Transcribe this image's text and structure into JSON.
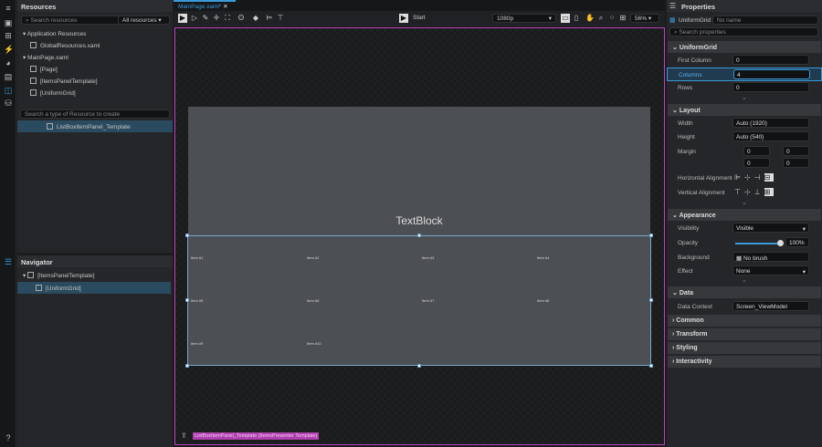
{
  "resources": {
    "title": "Resources",
    "search_placeholder": "Search resources",
    "filter": "All resources",
    "tree": [
      "Application Resources",
      "GlobalResources.xaml",
      "MainPage.xaml",
      "[Page]",
      "[ItemsPanelTemplate]",
      "[UniformGrid]"
    ],
    "create_placeholder": "Search a type of Resource to create",
    "selected_resource": "ListBoxItemPanel_Template"
  },
  "navigator": {
    "title": "Navigator",
    "items": [
      "[ItemsPanelTemplate]",
      "[UniformGrid]"
    ]
  },
  "document": {
    "tab": "MainPage.xaml*",
    "start_label": "Start",
    "resolution": "1080p",
    "zoom": "56%"
  },
  "canvas": {
    "textblock": "TextBlock",
    "items": [
      "Item #1",
      "Item #2",
      "Item #3",
      "Item #4",
      "Item #5",
      "Item #6",
      "Item #7",
      "Item #8",
      "Item #9",
      "Item #10"
    ],
    "breadcrumb": "ListBoxItemPanel_Template (ItemsPresenter Template)"
  },
  "properties": {
    "title": "Properties",
    "element_type": "UniformGrid",
    "name_placeholder": "No name",
    "search_placeholder": "Search properties",
    "uniformgrid": {
      "title": "UniformGrid",
      "first_column_label": "First Column",
      "first_column": "0",
      "columns_label": "Columns",
      "columns": "4",
      "rows_label": "Rows",
      "rows": "0"
    },
    "layout": {
      "title": "Layout",
      "width_label": "Width",
      "width": "Auto (1920)",
      "height_label": "Height",
      "height": "Auto (540)",
      "margin_label": "Margin",
      "margin": [
        "0",
        "0",
        "0",
        "0"
      ],
      "halign_label": "Horizontal Alignment",
      "valign_label": "Vertical Alignment"
    },
    "appearance": {
      "title": "Appearance",
      "visibility_label": "Visibility",
      "visibility": "Visible",
      "opacity_label": "Opacity",
      "opacity": "100%",
      "opacity_value": 1.0,
      "background_label": "Background",
      "background": "No brush",
      "effect_label": "Effect",
      "effect": "None"
    },
    "data": {
      "title": "Data",
      "context_label": "Data Context",
      "context": "Screen_ViewModel"
    },
    "collapsed": [
      "Common",
      "Transform",
      "Styling",
      "Interactivity"
    ]
  },
  "colors": {
    "accent": "#3a9ad9",
    "selection": "#c040c0"
  }
}
